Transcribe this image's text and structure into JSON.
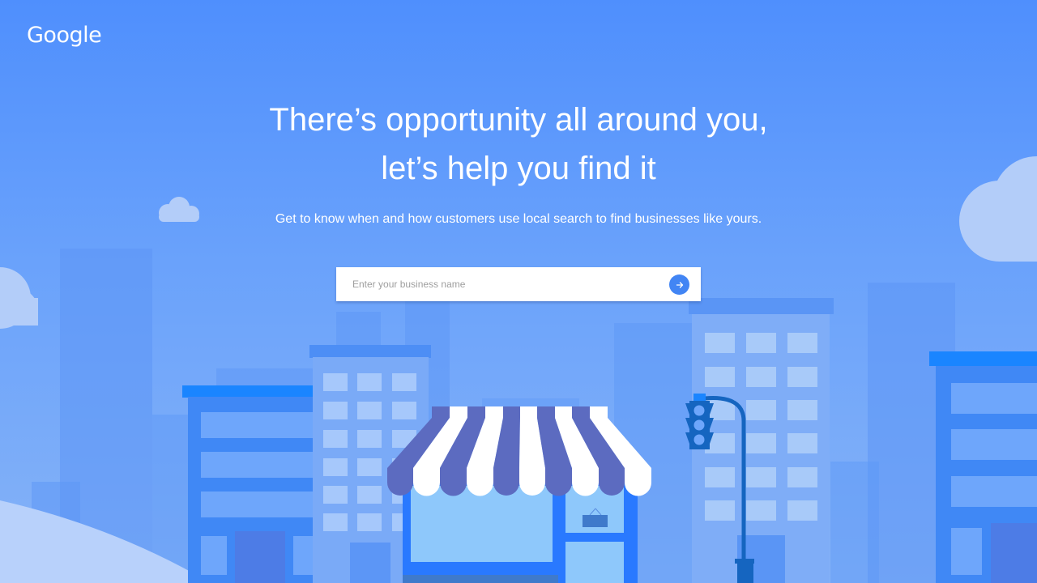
{
  "brand": {
    "logo_text": "Google"
  },
  "hero": {
    "headline_line1": "There’s opportunity all around you,",
    "headline_line2": "let’s help you find it",
    "subtitle": "Get to know when and how customers use local search to find businesses like yours."
  },
  "search": {
    "placeholder": "Enter your business name",
    "value": "",
    "submit_icon": "arrow-right-icon"
  },
  "colors": {
    "background_top": "#4f8ffd",
    "background_bottom": "#86b3f7",
    "accent": "#4285f4",
    "awning_stripe": "#5c6bc0",
    "text": "#ffffff"
  }
}
